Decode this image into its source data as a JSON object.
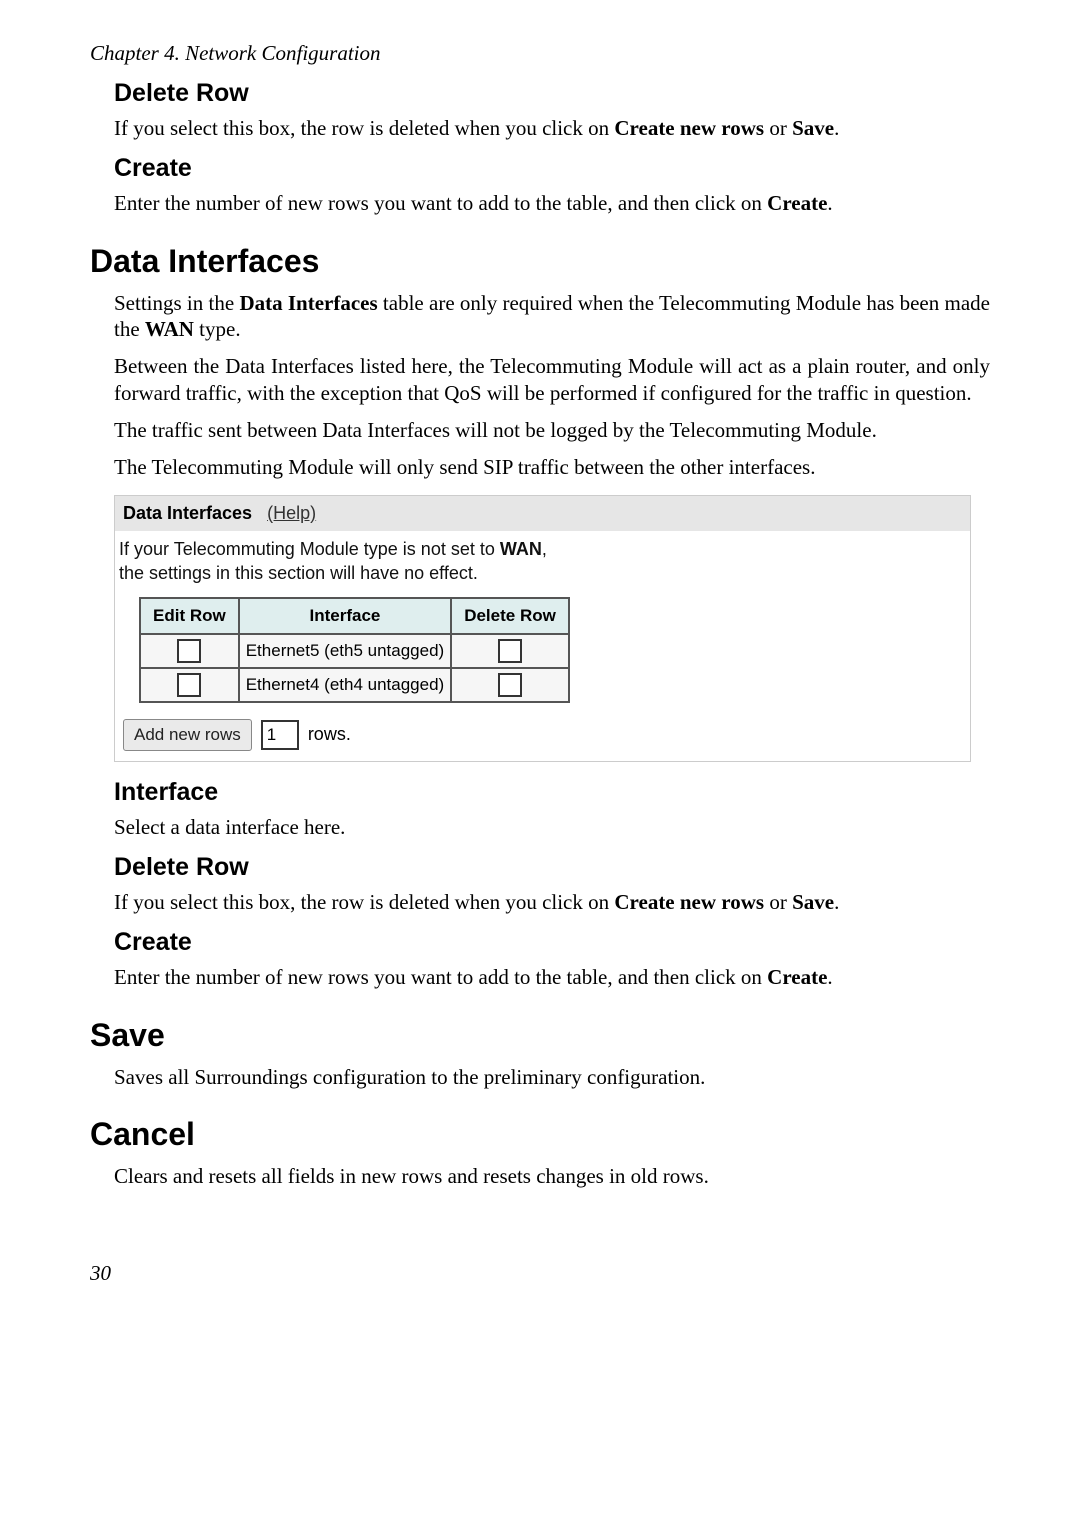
{
  "chapter_line": "Chapter 4. Network Configuration",
  "page_number": "30",
  "sections": {
    "deleteRow1": {
      "heading": "Delete Row",
      "text_before": "If you select this box, the row is deleted when you click on ",
      "bold1": "Create new rows",
      "mid": " or ",
      "bold2": "Save",
      "after": "."
    },
    "create1": {
      "heading": "Create",
      "text_before": "Enter the number of new rows you want to add to the table, and then click on ",
      "bold1": "Create",
      "after": "."
    },
    "dataInterfaces": {
      "heading": "Data Interfaces",
      "p1_before": "Settings in the ",
      "p1_bold1": "Data Interfaces",
      "p1_mid": " table are only required when the Telecommuting Module has been made the ",
      "p1_bold2": "WAN",
      "p1_after": " type.",
      "p2": "Between the Data Interfaces listed here, the Telecommuting Module will act as a plain router, and only forward traffic, with the exception that QoS will be performed if configured for the traffic in question.",
      "p3": "The traffic sent between Data Interfaces will not be logged by the Telecommuting Module.",
      "p4": "The Telecommuting Module will only send SIP traffic between the other interfaces."
    },
    "panel": {
      "title": "Data Interfaces",
      "help": "(Help)",
      "note_before": "If your Telecommuting Module type is not set to ",
      "note_bold": "WAN",
      "note_after": ",",
      "note_line2": "the settings in this section will have no effect.",
      "headers": {
        "editRow": "Edit Row",
        "interface": "Interface",
        "deleteRow": "Delete Row"
      },
      "rows": [
        {
          "interface": "Ethernet5 (eth5 untagged)"
        },
        {
          "interface": "Ethernet4 (eth4 untagged)"
        }
      ],
      "addBtn": "Add new rows",
      "rowCount": "1",
      "rowsLabel": "rows."
    },
    "interfaceSec": {
      "heading": "Interface",
      "text": "Select a data interface here."
    },
    "deleteRow2": {
      "heading": "Delete Row",
      "text_before": "If you select this box, the row is deleted when you click on ",
      "bold1": "Create new rows",
      "mid": " or ",
      "bold2": "Save",
      "after": "."
    },
    "create2": {
      "heading": "Create",
      "text_before": "Enter the number of new rows you want to add to the table, and then click on ",
      "bold1": "Create",
      "after": "."
    },
    "save": {
      "heading": "Save",
      "text": "Saves all Surroundings configuration to the preliminary configuration."
    },
    "cancel": {
      "heading": "Cancel",
      "text": "Clears and resets all fields in new rows and resets changes in old rows."
    }
  }
}
